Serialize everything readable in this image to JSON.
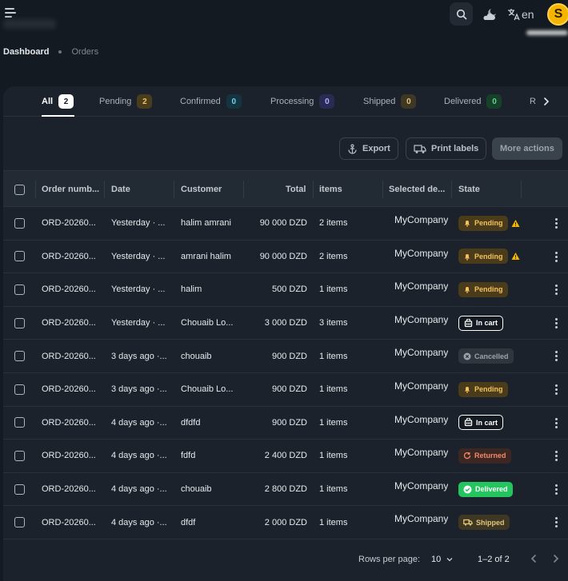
{
  "header": {
    "language": "en",
    "avatar_initial": "S"
  },
  "breadcrumb": {
    "current": "Dashboard",
    "last": "Orders"
  },
  "tabs": [
    {
      "label": "All",
      "count": "2",
      "bg": "#ffffff",
      "fg": "#111820"
    },
    {
      "label": "Pending",
      "count": "2",
      "bg": "#4a3d1d",
      "fg": "#f5c15c"
    },
    {
      "label": "Confirmed",
      "count": "0",
      "bg": "#143540",
      "fg": "#6fd3ef"
    },
    {
      "label": "Processing",
      "count": "0",
      "bg": "#2b2a52",
      "fg": "#b3b0ff"
    },
    {
      "label": "Shipped",
      "count": "0",
      "bg": "#3d3723",
      "fg": "#e3c57a"
    },
    {
      "label": "Delivered",
      "count": "0",
      "bg": "#15402a",
      "fg": "#62d38e"
    },
    {
      "label": "R",
      "count": "",
      "bg": "",
      "fg": ""
    }
  ],
  "toolbar": {
    "export_label": "Export",
    "print_label": "Print labels",
    "more_label": "More actions"
  },
  "columns": {
    "order": "Order numb...",
    "date": "Date",
    "customer": "Customer",
    "total": "Total",
    "items": "items",
    "delivery": "Selected de...",
    "state": "State"
  },
  "rows": [
    {
      "order": "ORD-20260...",
      "date": "Yesterday · ...",
      "customer": "halim amrani",
      "total": "90 000 DZD",
      "items": "2 items",
      "company": "MyCompany",
      "state": "Pending",
      "warn": true
    },
    {
      "order": "ORD-20260...",
      "date": "Yesterday · ...",
      "customer": "amrani halim",
      "total": "90 000 DZD",
      "items": "2 items",
      "company": "MyCompany",
      "state": "Pending",
      "warn": true
    },
    {
      "order": "ORD-20260...",
      "date": "Yesterday · ...",
      "customer": "halim",
      "total": "500 DZD",
      "items": "1 items",
      "company": "MyCompany",
      "state": "Pending",
      "warn": false
    },
    {
      "order": "ORD-20260...",
      "date": "Yesterday · ...",
      "customer": "Chouaib Lo...",
      "total": "3 000 DZD",
      "items": "3 items",
      "company": "MyCompany",
      "state": "In cart",
      "warn": false
    },
    {
      "order": "ORD-20260...",
      "date": "3 days ago ·...",
      "customer": "chouaib",
      "total": "900 DZD",
      "items": "1 items",
      "company": "MyCompany",
      "state": "Cancelled",
      "warn": false
    },
    {
      "order": "ORD-20260...",
      "date": "3 days ago ·...",
      "customer": "Chouaib Lo...",
      "total": "900 DZD",
      "items": "1 items",
      "company": "MyCompany",
      "state": "Pending",
      "warn": false
    },
    {
      "order": "ORD-20260...",
      "date": "4 days ago ·...",
      "customer": "dfdfd",
      "total": "900 DZD",
      "items": "1 items",
      "company": "MyCompany",
      "state": "In cart",
      "warn": false
    },
    {
      "order": "ORD-20260...",
      "date": "4 days ago ·...",
      "customer": "fdfd",
      "total": "2 400 DZD",
      "items": "1 items",
      "company": "MyCompany",
      "state": "Returned",
      "warn": false
    },
    {
      "order": "ORD-20260...",
      "date": "4 days ago ·...",
      "customer": "chouaib",
      "total": "2 800 DZD",
      "items": "1 items",
      "company": "MyCompany",
      "state": "Delivered",
      "warn": false
    },
    {
      "order": "ORD-20260...",
      "date": "4 days ago ·...",
      "customer": "dfdf",
      "total": "2 000 DZD",
      "items": "1 items",
      "company": "MyCompany",
      "state": "Shipped",
      "warn": false
    }
  ],
  "states": {
    "Pending": {
      "bg": "#4a3b1b",
      "fg": "#f5c15c",
      "icon": "bell-icon"
    },
    "In cart": {
      "bg": "#141a21",
      "fg": "#ffffff",
      "icon": "cart-icon"
    },
    "Cancelled": {
      "bg": "#2f363e",
      "fg": "#9aa3ac",
      "icon": "x-circle-icon"
    },
    "Returned": {
      "bg": "#3d2722",
      "fg": "#f08a6a",
      "icon": "return-icon"
    },
    "Delivered": {
      "bg": "#22c55e",
      "fg": "#ffffff",
      "icon": "check-circle-icon"
    },
    "Shipped": {
      "bg": "#3d3723",
      "fg": "#e3c57a",
      "icon": "truck-icon"
    }
  },
  "footer": {
    "rows_per_page_label": "Rows per page:",
    "rows_per_page_value": "10",
    "range": "1–2 of 2"
  }
}
